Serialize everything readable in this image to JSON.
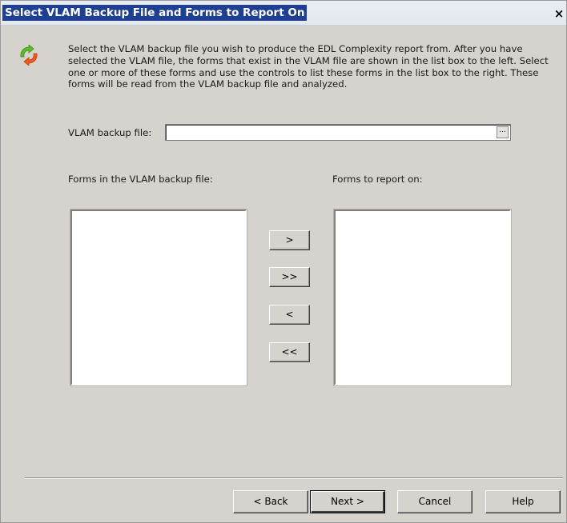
{
  "window": {
    "title": "Select VLAM Backup File and Forms to Report On",
    "close_label": "×"
  },
  "instructions": "Select the VLAM backup file you wish to produce the EDL Complexity report from.  After you have selected the VLAM file, the forms that exist in the VLAM file are shown in the list box to the left.  Select one or more of these forms and use the controls to list these forms in the list box to the right.  These forms will be read from the VLAM backup file and analyzed.",
  "backup_file": {
    "label": "VLAM backup file:",
    "value": "",
    "browse_label": "..."
  },
  "available_forms": {
    "label": "Forms in the VLAM backup file:",
    "items": []
  },
  "selected_forms": {
    "label": "Forms to report on:",
    "items": []
  },
  "move_buttons": {
    "add_one": ">",
    "add_all": ">>",
    "remove_one": "<",
    "remove_all": "<<"
  },
  "nav_buttons": {
    "back": "< Back",
    "next": "Next >",
    "cancel": "Cancel",
    "help": "Help"
  },
  "icons": {
    "wizard": "refresh-arrows-icon"
  },
  "colors": {
    "title_highlight": "#1f3f92",
    "dialog_background": "#d6d3ce",
    "icon_green": "#5dbb2e",
    "icon_orange": "#f05a1e"
  }
}
